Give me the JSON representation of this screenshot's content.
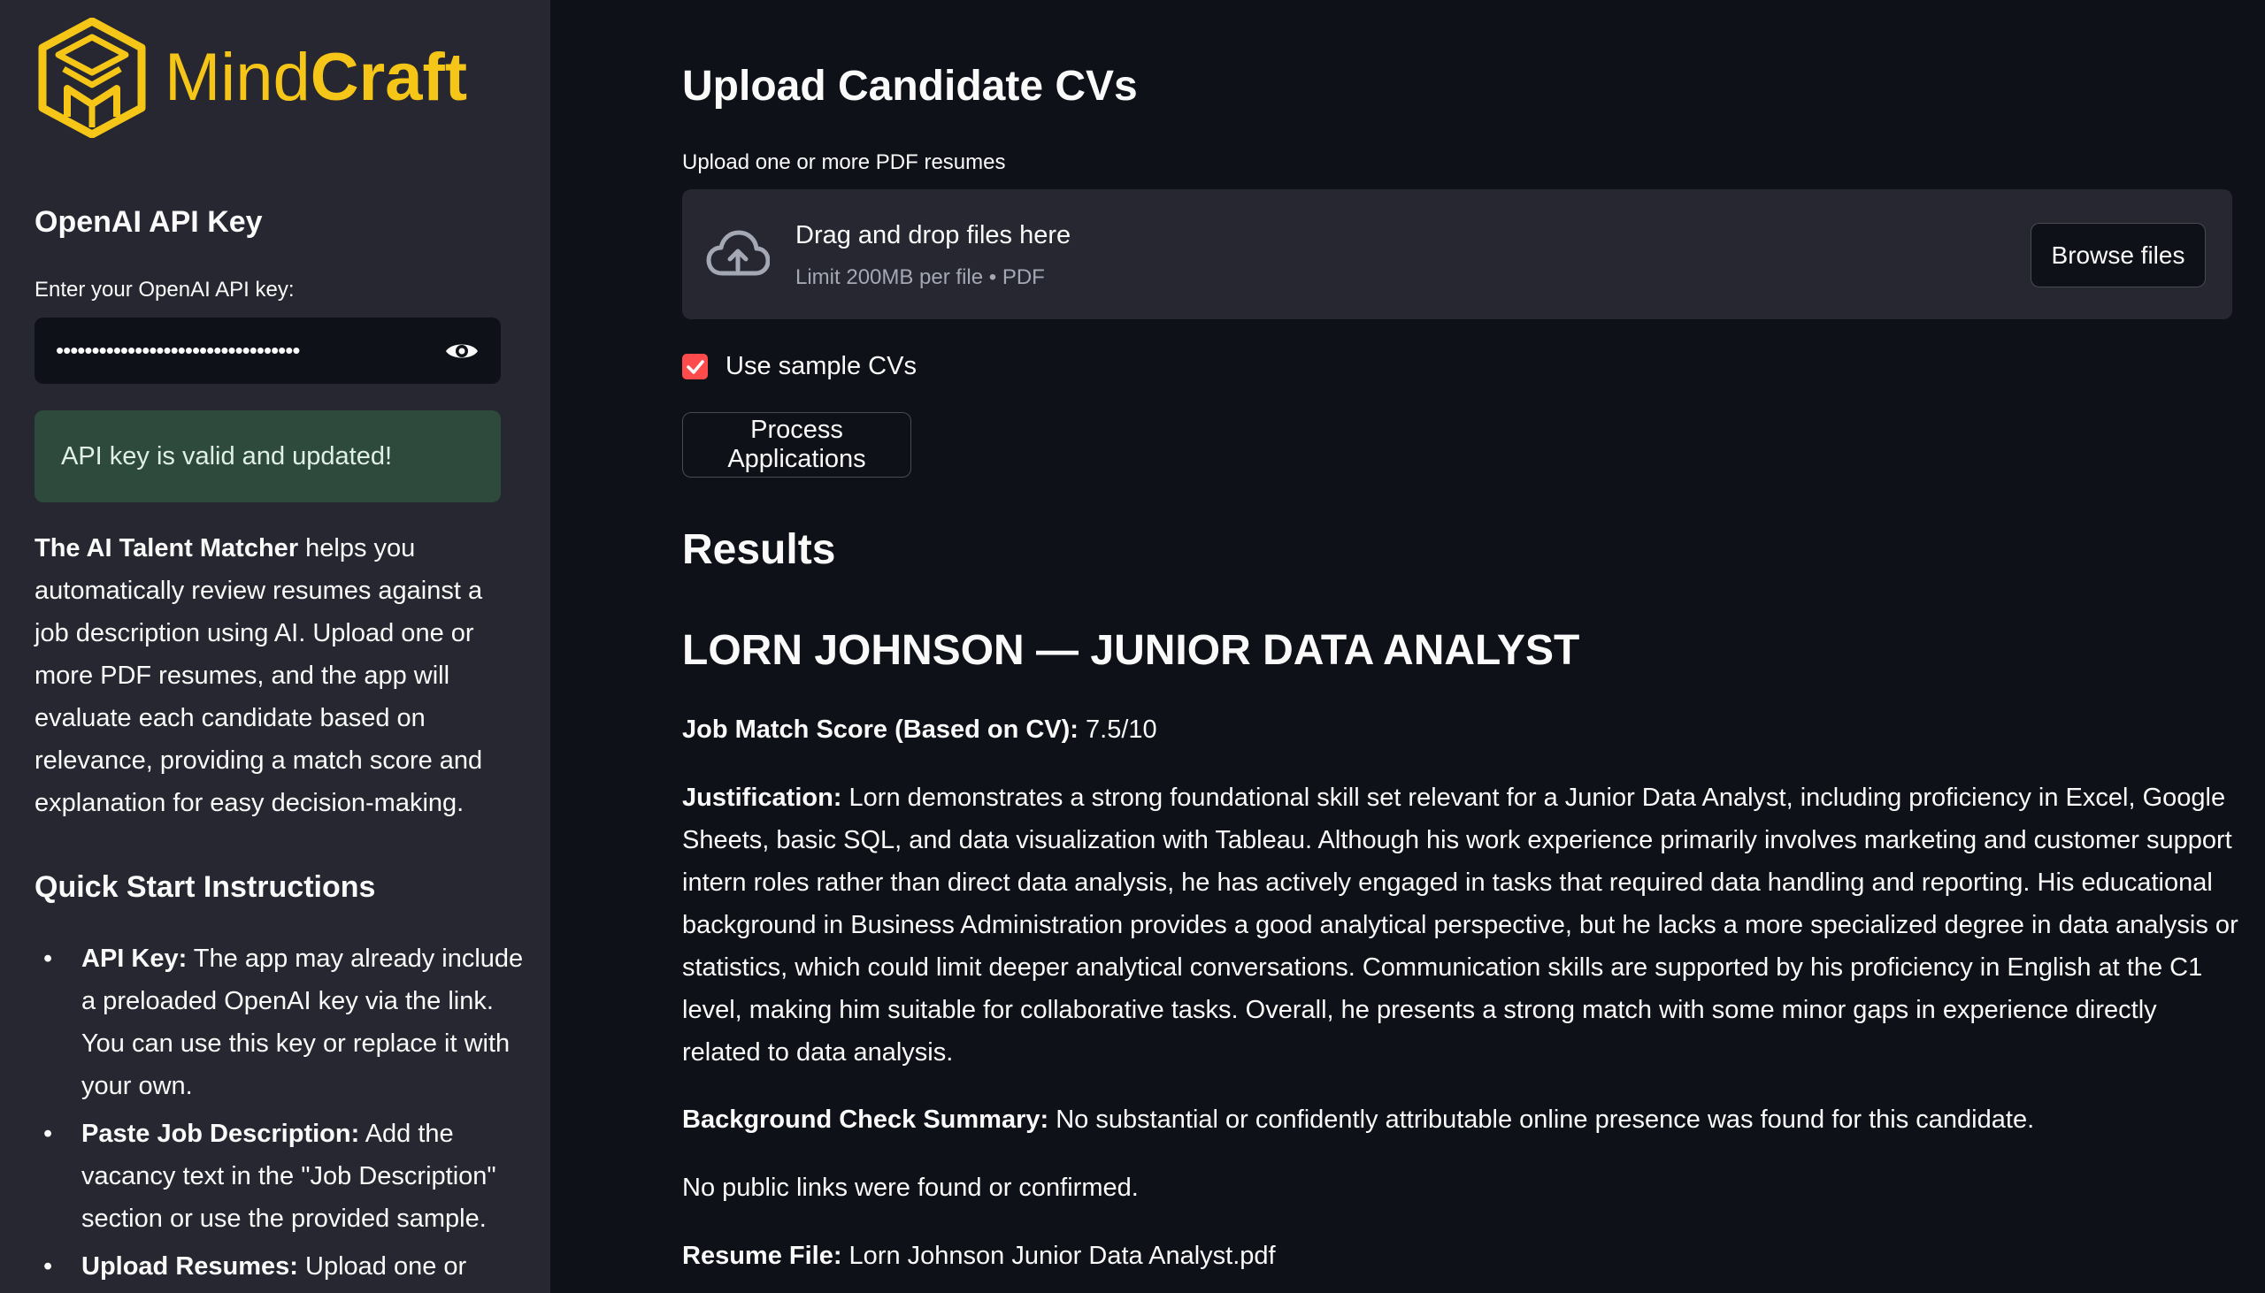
{
  "sidebar": {
    "logo": {
      "text_light": "Mind",
      "text_bold": "Craft",
      "icon": "mindcraft-logo-icon",
      "brand_color": "#f5c518"
    },
    "api_section": {
      "heading": "OpenAI API Key",
      "label": "Enter your OpenAI API key:",
      "masked_value": "••••••••••••••••••••••••••••••••••",
      "toggle_icon": "eye-icon",
      "success_message": "API key is valid and updated!"
    },
    "about": {
      "bold": "The AI Talent Matcher",
      "text": " helps you automatically review resumes against a job description using AI. Upload one or more PDF resumes, and the app will evaluate each candidate based on relevance, providing a match score and explanation for easy decision-making."
    },
    "quick_start": {
      "heading": "Quick Start Instructions",
      "items": [
        {
          "bold": "API Key:",
          "text": " The app may already include a preloaded OpenAI key via the link. You can use this key or replace it with your own."
        },
        {
          "bold": "Paste Job Description:",
          "text": " Add the vacancy text in the \"Job Description\" section or use the provided sample."
        },
        {
          "bold": "Upload Resumes:",
          "text": " Upload one or"
        }
      ]
    }
  },
  "main": {
    "upload": {
      "heading": "Upload Candidate CVs",
      "label": "Upload one or more PDF resumes",
      "drop_title": "Drag and drop files here",
      "drop_subtitle": "Limit 200MB per file • PDF",
      "upload_icon": "cloud-upload-icon",
      "browse_label": "Browse files"
    },
    "sample_checkbox": {
      "label": "Use sample CVs",
      "checked": true,
      "color": "#ff4b4b"
    },
    "process_label": "Process Applications",
    "results": {
      "heading": "Results",
      "candidate_title": "LORN JOHNSON — JUNIOR DATA ANALYST",
      "score_label": "Job Match Score (Based on CV):",
      "score_value": " 7.5/10",
      "justification_label": "Justification:",
      "justification_text": " Lorn demonstrates a strong foundational skill set relevant for a Junior Data Analyst, including proficiency in Excel, Google Sheets, basic SQL, and data visualization with Tableau. Although his work experience primarily involves marketing and customer support intern roles rather than direct data analysis, he has actively engaged in tasks that required data handling and reporting. His educational background in Business Administration provides a good analytical perspective, but he lacks a more specialized degree in data analysis or statistics, which could limit deeper analytical conversations. Communication skills are supported by his proficiency in English at the C1 level, making him suitable for collaborative tasks. Overall, he presents a strong match with some minor gaps in experience directly related to data analysis.",
      "background_label": "Background Check Summary:",
      "background_text": " No substantial or confidently attributable online presence was found for this candidate.",
      "public_links": "No public links were found or confirmed.",
      "resume_label": "Resume File:",
      "resume_value": " Lorn Johnson Junior Data Analyst.pdf"
    }
  }
}
